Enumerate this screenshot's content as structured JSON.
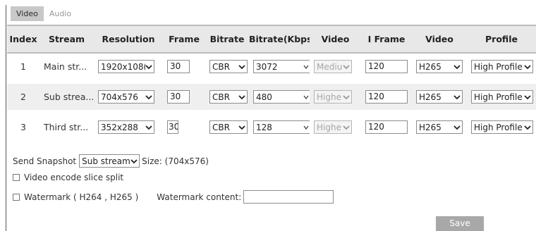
{
  "tabs": {
    "video": "Video",
    "audio": "Audio"
  },
  "table": {
    "headers": [
      "Index",
      "Stream",
      "Resolution",
      "Frame",
      "Bitrate",
      "Bitrate(Kbps)",
      "Video",
      "I Frame",
      "Video",
      "Profile"
    ],
    "rows": [
      {
        "index": "1",
        "stream": "Main str...",
        "resolution": "1920x108(",
        "frame": "30",
        "bitrate": "CBR",
        "kbps": "3072",
        "quality": "Mediu",
        "iframe": "120",
        "codec": "H265",
        "profile": "High Profile"
      },
      {
        "index": "2",
        "stream": "Sub strea...",
        "resolution": "704x576",
        "frame": "30",
        "bitrate": "CBR",
        "kbps": "480",
        "quality": "Highe",
        "iframe": "120",
        "codec": "H265",
        "profile": "High Profile"
      },
      {
        "index": "3",
        "stream": "Third str...",
        "resolution": "352x288",
        "frame": "30",
        "bitrate": "CBR",
        "kbps": "128",
        "quality": "Highe",
        "iframe": "120",
        "codec": "H265",
        "profile": "High Profile"
      }
    ]
  },
  "snapshot": {
    "label": "Send Snapshot",
    "value": "Sub stream",
    "size": "Size: (704x576)"
  },
  "slice_split": {
    "label": "Video encode slice split"
  },
  "watermark": {
    "label": "Watermark ( H264 , H265 )",
    "content_label": "Watermark content:",
    "content_value": ""
  },
  "save_label": "Save"
}
